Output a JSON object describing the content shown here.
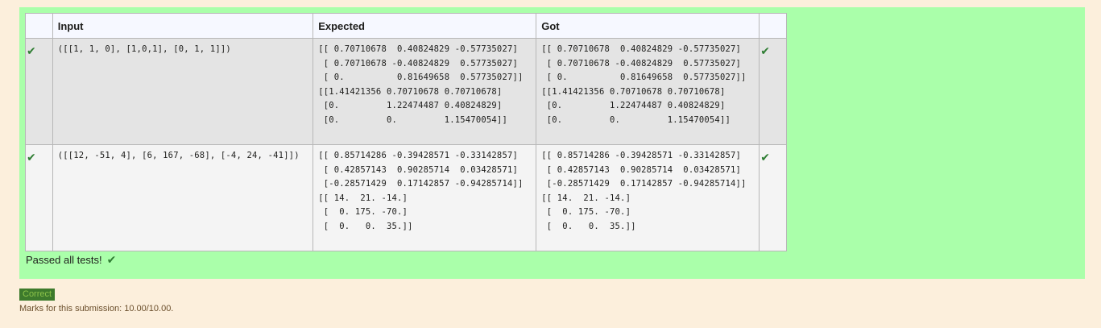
{
  "table": {
    "headers": {
      "input": "Input",
      "expected": "Expected",
      "got": "Got"
    },
    "rows": [
      {
        "input": "([[1, 1, 0], [1,0,1], [0, 1, 1]])",
        "expected": "[[ 0.70710678  0.40824829 -0.57735027]\n [ 0.70710678 -0.40824829  0.57735027]\n [ 0.          0.81649658  0.57735027]]\n[[1.41421356 0.70710678 0.70710678]\n [0.         1.22474487 0.40824829]\n [0.         0.         1.15470054]]",
        "got": "[[ 0.70710678  0.40824829 -0.57735027]\n [ 0.70710678 -0.40824829  0.57735027]\n [ 0.          0.81649658  0.57735027]]\n[[1.41421356 0.70710678 0.70710678]\n [0.         1.22474487 0.40824829]\n [0.         0.         1.15470054]]",
        "status_icon": "check-icon"
      },
      {
        "input": "([[12, -51, 4], [6, 167, -68], [-4, 24, -41]])",
        "expected": "[[ 0.85714286 -0.39428571 -0.33142857]\n [ 0.42857143  0.90285714  0.03428571]\n [-0.28571429  0.17142857 -0.94285714]]\n[[ 14.  21. -14.]\n [  0. 175. -70.]\n [  0.   0.  35.]]",
        "got": "[[ 0.85714286 -0.39428571 -0.33142857]\n [ 0.42857143  0.90285714  0.03428571]\n [-0.28571429  0.17142857 -0.94285714]]\n[[ 14.  21. -14.]\n [  0. 175. -70.]\n [  0.   0.  35.]]",
        "status_icon": "check-icon"
      }
    ]
  },
  "summary": {
    "passed_text": "Passed all tests!"
  },
  "grade": {
    "badge": "Correct",
    "marks_text": "Marks for this submission: 10.00/10.00."
  },
  "colors": {
    "page_bg": "#fcefdc",
    "result_bg": "#aaffaa",
    "check": "#2e7d32",
    "badge_bg": "#3d7a2c"
  }
}
